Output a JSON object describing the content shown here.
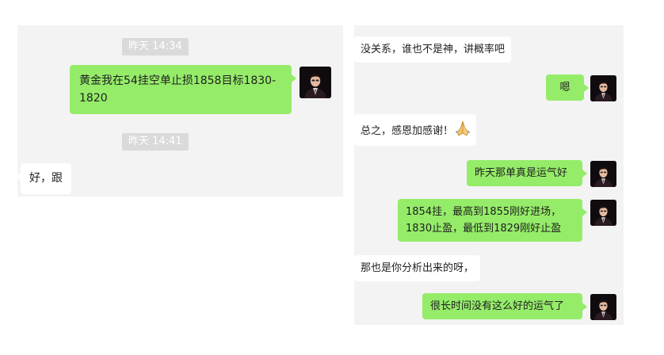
{
  "left_chat": {
    "timestamp_1": "昨天 14:34",
    "msg_1": "黄金我在54挂空单止损1858目标1830-1820",
    "timestamp_2": "昨天 14:41",
    "msg_2": "好，跟"
  },
  "right_chat": {
    "msg_1": "没关系，谁也不是神，讲概率吧",
    "msg_2": "嗯",
    "msg_3": "总之，感恩加感谢！",
    "msg_3_icon": "praying-hands-icon",
    "msg_4": "昨天那单真是运气好",
    "msg_5": "1854挂，最高到1855刚好进场，1830止盈，最低到1829刚好止盈",
    "msg_6": "那也是你分析出来的呀，",
    "msg_7": "很长时间没有这么好的运气了"
  },
  "colors": {
    "panel_bg": "#f3f3f3",
    "sent_bubble": "#95ec69",
    "received_bubble": "#ffffff",
    "timestamp_bg": "#dadada"
  }
}
